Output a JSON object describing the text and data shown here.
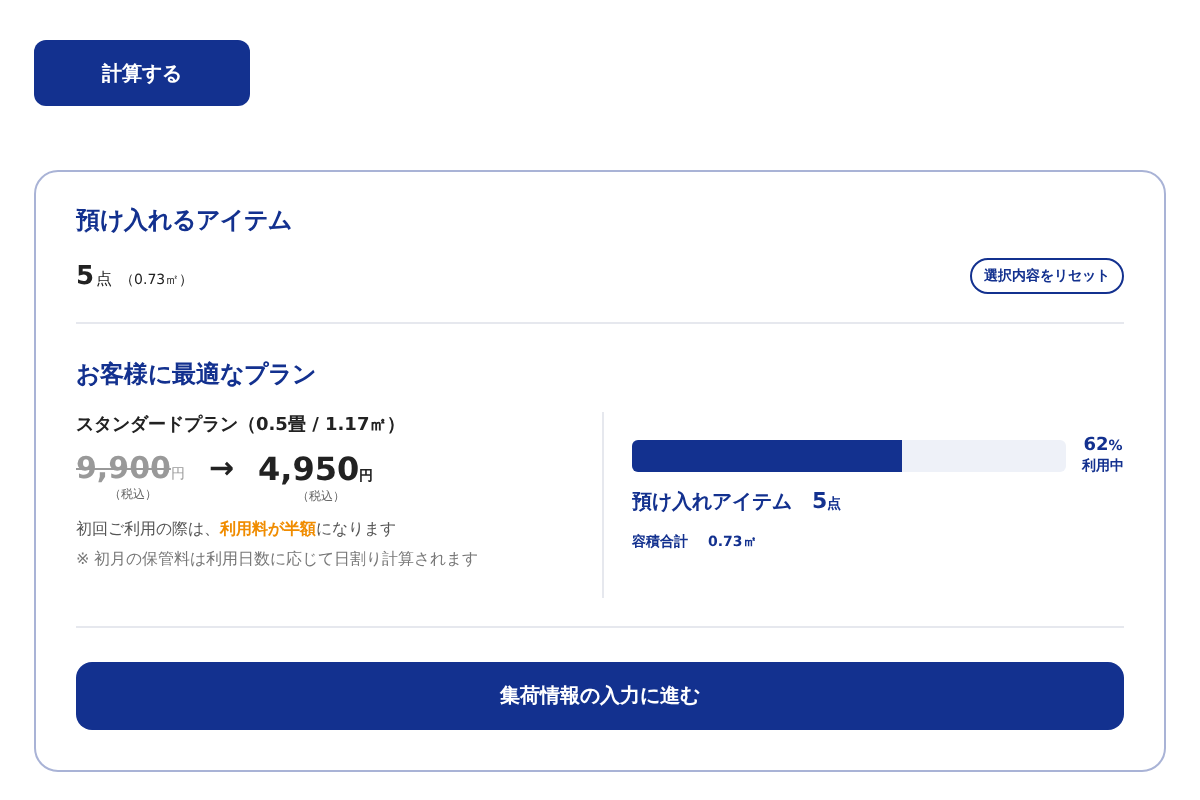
{
  "calc_button": "計算する",
  "items": {
    "title": "預け入れるアイテム",
    "count": "5",
    "count_unit": "点",
    "volume": "（0.73㎡）",
    "reset_button": "選択内容をリセット"
  },
  "plan": {
    "title": "お客様に最適なプラン",
    "name": "スタンダードプラン（0.5畳 / 1.17㎡）",
    "old_price": "9,900",
    "old_unit": "円",
    "old_tax": "（税込）",
    "arrow": "→",
    "new_price": "4,950",
    "new_unit": "円",
    "new_tax": "（税込）",
    "notice": "初回ご利用の際は、**利用料が半額**になります",
    "footnote": "※ 初月の保管料は利用日数に応じて日割り計算されます"
  },
  "usage": {
    "level": 0.62,
    "percent": "62",
    "percent_unit": "%",
    "status": "利用中",
    "items_label": "預け入れアイテム",
    "items_count": "5",
    "items_unit": "点",
    "volume_label": "容積合計",
    "volume_value": "0.73㎡"
  },
  "next_button": "集荷情報の入力に進む"
}
